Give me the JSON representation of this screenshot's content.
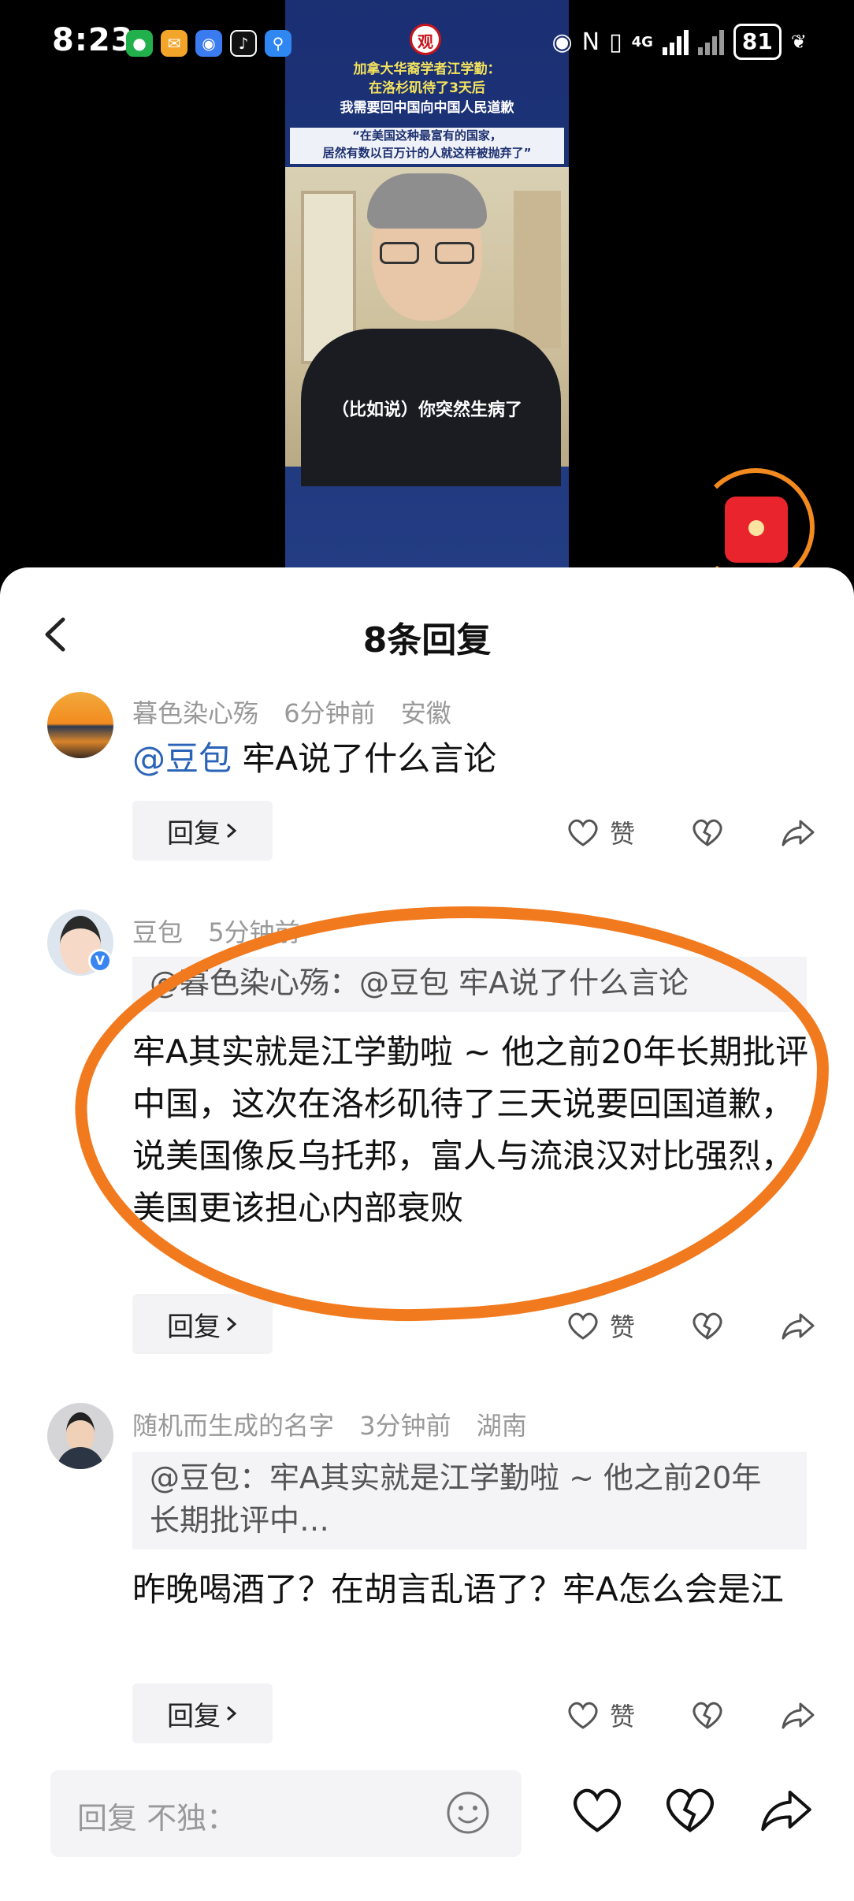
{
  "status": {
    "time": "8:23",
    "battery": "81",
    "network": "4G"
  },
  "video": {
    "title_line1": "加拿大华裔学者江学勤：",
    "title_line2": "在洛杉矶待了3天后",
    "title_line3": "我需要回中国向中国人民道歉",
    "quote_line1": "“在美国这种最富有的国家，",
    "quote_line2": "居然有数以百万计的人就这样被抛弃了”",
    "subtitle": "（比如说）你突然生病了",
    "logo": "观"
  },
  "sheet": {
    "title": "8条回复"
  },
  "comments": [
    {
      "user": "暮色染心殇",
      "time": "6分钟前",
      "location": "安徽",
      "mention": "@豆包",
      "text": " 牢A说了什么言论",
      "reply_label": "回复",
      "like_label": "赞"
    },
    {
      "user": "豆包",
      "time": "5分钟前",
      "location": "",
      "quote": "@暮色染心殇：@豆包 牢A说了什么言论",
      "text": "牢A其实就是江学勤啦 ~ 他之前20年长期批评中国，这次在洛杉矶待了三天说要回国道歉，说美国像反乌托邦，富人与流浪汉对比强烈，美国更该担心内部衰败",
      "reply_label": "回复",
      "like_label": "赞"
    },
    {
      "user": "随机而生成的名字",
      "time": "3分钟前",
      "location": "湖南",
      "quote": "@豆包：牢A其实就是江学勤啦 ~ 他之前20年长期批评中…",
      "text": "昨晚喝酒了？在胡言乱语了？牢A怎么会是江",
      "reply_label": "回复",
      "like_label": "赞"
    }
  ],
  "input": {
    "placeholder": "回复 不独："
  },
  "colors": {
    "annotation": "#f27a1e",
    "mention": "#2a63b8",
    "verified": "#3a86f1"
  }
}
